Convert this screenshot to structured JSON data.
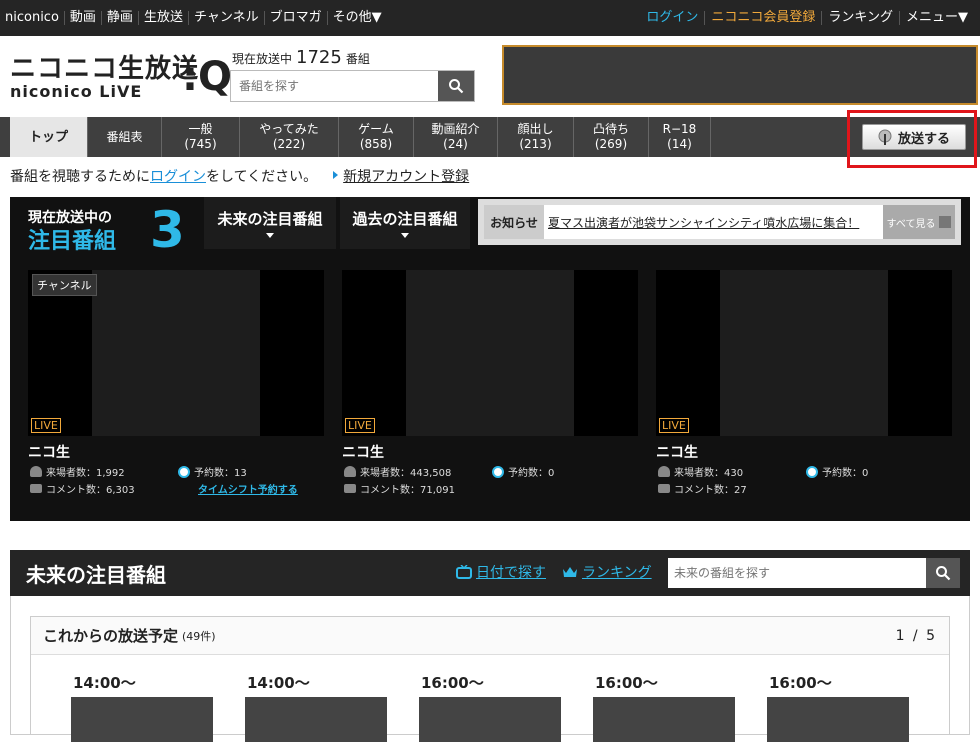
{
  "topbar": {
    "left": [
      "niconico",
      "動画",
      "静画",
      "生放送",
      "チャンネル",
      "ブロマガ",
      "その他▼"
    ],
    "login": "ログイン",
    "register": "ニコニコ会員登録",
    "ranking": "ランキング",
    "menu": "メニュー▼"
  },
  "logo": {
    "line1": "ニコニコ生放送",
    "line2": "niconico LiVE",
    "q": ":Q"
  },
  "oncount": {
    "prefix": "現在放送中",
    "count": "1725",
    "suffix": "番組"
  },
  "search": {
    "placeholder": "番組を探す"
  },
  "nav": {
    "tabs": [
      {
        "label": "トップ",
        "count": ""
      },
      {
        "label": "番組表",
        "count": ""
      },
      {
        "label": "一般",
        "count": "(745)"
      },
      {
        "label": "やってみた",
        "count": "(222)"
      },
      {
        "label": "ゲーム",
        "count": "(858)"
      },
      {
        "label": "動画紹介",
        "count": "(24)"
      },
      {
        "label": "顔出し",
        "count": "(213)"
      },
      {
        "label": "凸待ち",
        "count": "(269)"
      },
      {
        "label": "R−18",
        "count": "(14)"
      }
    ],
    "broadcast": "放送する"
  },
  "loginline": {
    "pre": "番組を視聴するために",
    "link": "ログイン",
    "post": "をしてください。",
    "newacc": "新規アカウント登録"
  },
  "featured": {
    "title1": "現在放送中の",
    "title2": "注目番組",
    "count": "3",
    "future_tab": "未来の注目番組",
    "past_tab": "過去の注目番組",
    "news_label": "お知らせ",
    "news_text": "夏マス出演者が池袋サンシャインシティ噴水広場に集合！",
    "news_more": "すべて見る"
  },
  "cards": [
    {
      "channel": "チャンネル",
      "live": "LIVE",
      "name": "ニコ生",
      "visitors": "来場者数：1,992",
      "comments": "コメント数：6,303",
      "reserve": "予約数：13",
      "timeshift": "タイムシフト予約する"
    },
    {
      "channel": "",
      "live": "LIVE",
      "name": "ニコ生",
      "visitors": "来場者数：443,508",
      "comments": "コメント数：71,091",
      "reserve": "予約数：0",
      "timeshift": ""
    },
    {
      "channel": "",
      "live": "LIVE",
      "name": "ニコ生",
      "visitors": "来場者数：430",
      "comments": "コメント数：27",
      "reserve": "予約数：0",
      "timeshift": ""
    }
  ],
  "future": {
    "title": "未来の注目番組",
    "by_date": "日付で探す",
    "ranking": "ランキング",
    "search_placeholder": "未来の番組を探す"
  },
  "schedule": {
    "title": "これからの放送予定",
    "count": "(49件)",
    "page": "1 / 5",
    "slots": [
      "14:00〜",
      "14:00〜",
      "16:00〜",
      "16:00〜",
      "16:00〜"
    ]
  },
  "colors": {
    "accent": "#2fb9e8",
    "orange": "#f2a93b",
    "highlight": "#e0151b"
  }
}
